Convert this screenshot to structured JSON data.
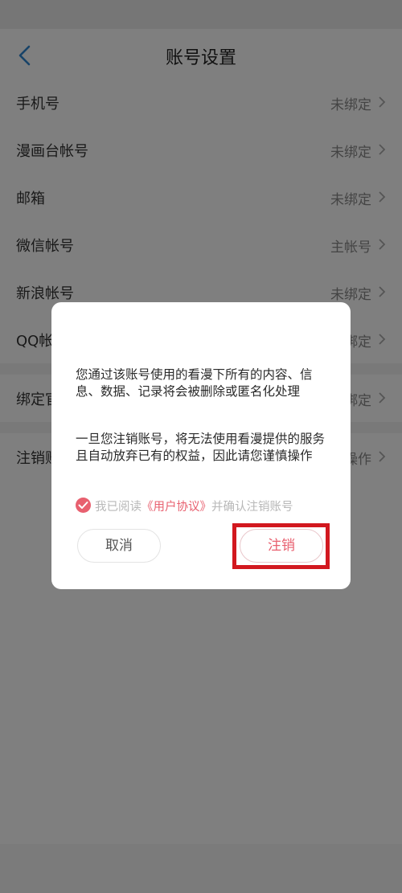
{
  "header": {
    "title": "账号设置"
  },
  "settings": {
    "rows": [
      {
        "label": "手机号",
        "value": "未绑定"
      },
      {
        "label": "漫画台帐号",
        "value": "未绑定"
      },
      {
        "label": "邮箱",
        "value": "未绑定"
      },
      {
        "label": "微信帐号",
        "value": "主帐号"
      },
      {
        "label": "新浪帐号",
        "value": "未绑定"
      },
      {
        "label": "QQ帐号",
        "value": "未绑定"
      }
    ],
    "bind_row": {
      "label": "绑定官",
      "value": "未绑定"
    },
    "cancel_row": {
      "label": "注销账号",
      "value": "操作"
    }
  },
  "dialog": {
    "paragraph1": "您通过该账号使用的看漫下所有的内容、信息、数据、记录将会被删除或匿名化处理",
    "paragraph2": "一旦您注销账号，将无法使用看漫提供的服务且自动放弃已有的权益，因此请您谨慎操作",
    "agree_prefix": "我已阅读",
    "agree_link": "《用户协议》",
    "agree_suffix": "并确认注销账号",
    "cancel_label": "取消",
    "confirm_label": "注销"
  },
  "colors": {
    "accent": "#e8606f",
    "highlight": "#d2181f"
  }
}
